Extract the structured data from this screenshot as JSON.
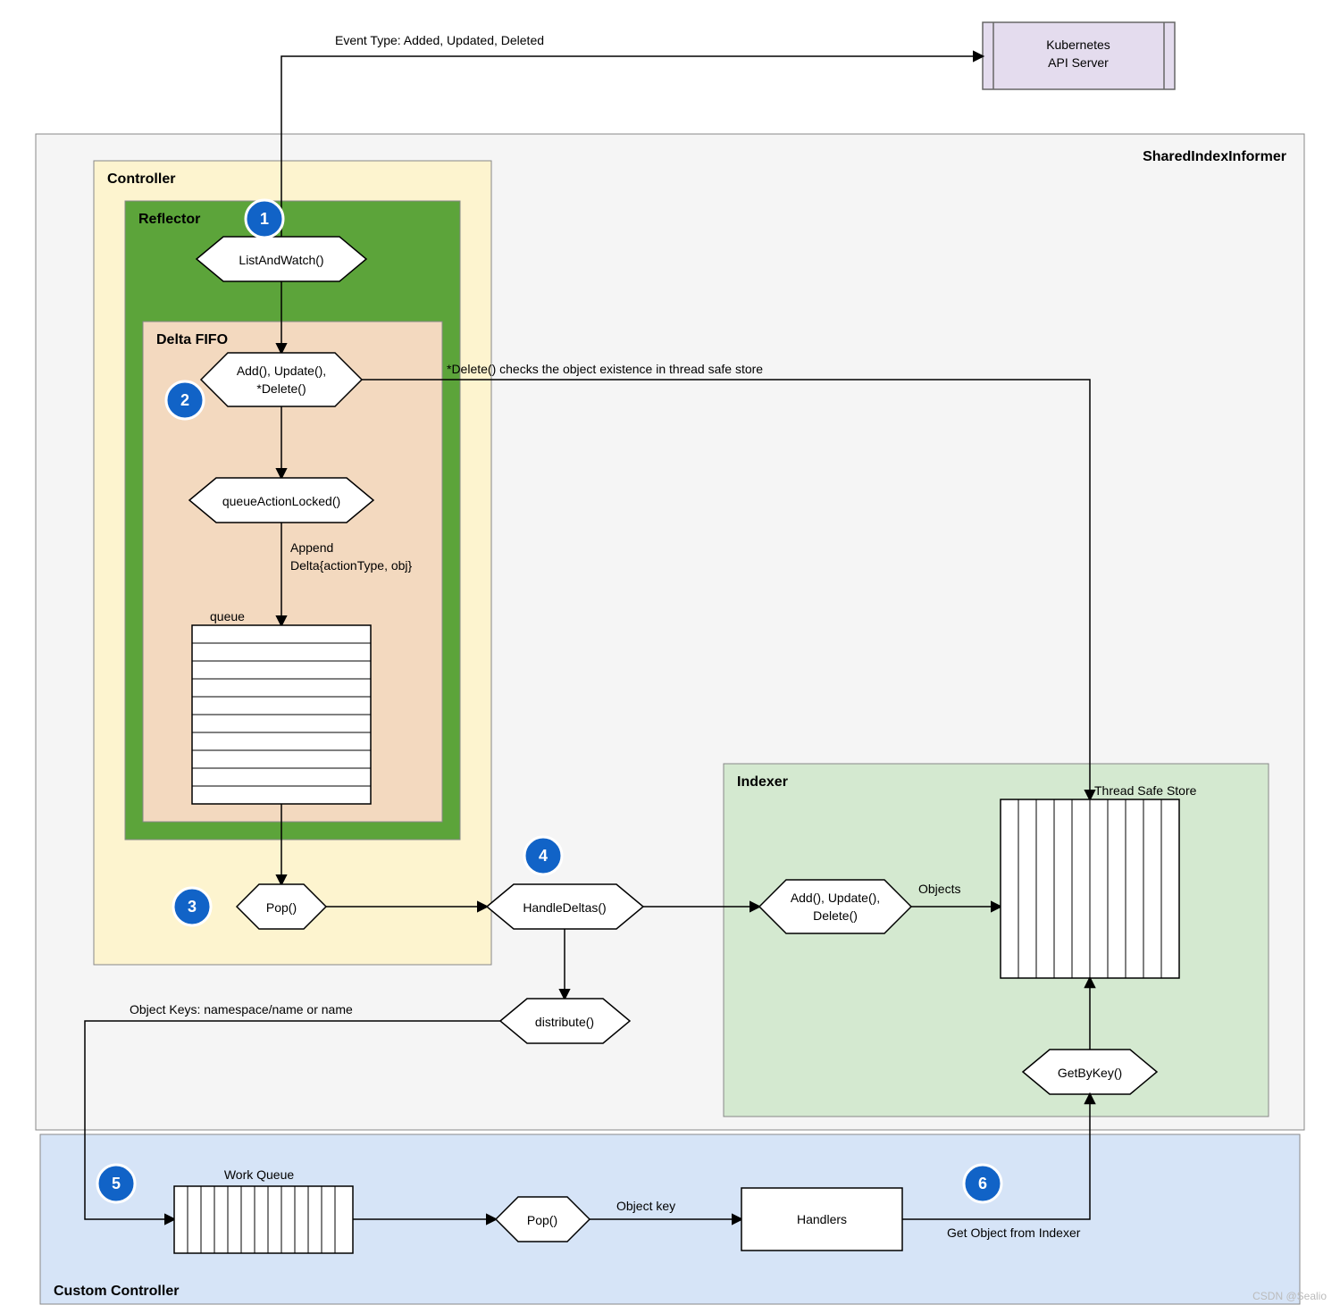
{
  "regions": {
    "sharedIndexInformer": "SharedIndexInformer",
    "controller": "Controller",
    "reflector": "Reflector",
    "deltaFifo": "Delta FIFO",
    "indexer": "Indexer",
    "customController": "Custom Controller"
  },
  "nodes": {
    "k8sApi": {
      "line1": "Kubernetes",
      "line2": "API Server"
    },
    "listAndWatch": "ListAndWatch()",
    "addUpdateDelete": {
      "line1": "Add(), Update(),",
      "line2": "*Delete()"
    },
    "queueActionLocked": "queueActionLocked()",
    "queueLabel": "queue",
    "pop": "Pop()",
    "handleDeltas": "HandleDeltas()",
    "distribute": "distribute()",
    "indexerOps": {
      "line1": "Add(), Update(),",
      "line2": "Delete()"
    },
    "threadSafeStore": "Thread Safe Store",
    "getByKey": "GetByKey()",
    "workQueueLabel": "Work Queue",
    "pop2": "Pop()",
    "handlers": "Handlers"
  },
  "edges": {
    "eventType": "Event Type: Added, Updated, Deleted",
    "deleteChecks": "*Delete() checks the object existence in thread safe store",
    "appendDelta": {
      "line1": "Append",
      "line2": "Delta{actionType, obj}"
    },
    "objectKeys": "Object Keys: namespace/name or name",
    "objectKey": "Object key",
    "objects": "Objects",
    "getObjFromIndexer": "Get Object from Indexer"
  },
  "badges": {
    "b1": "1",
    "b2": "2",
    "b3": "3",
    "b4": "4",
    "b5": "5",
    "b6": "6"
  },
  "watermark": "CSDN @Sealio"
}
